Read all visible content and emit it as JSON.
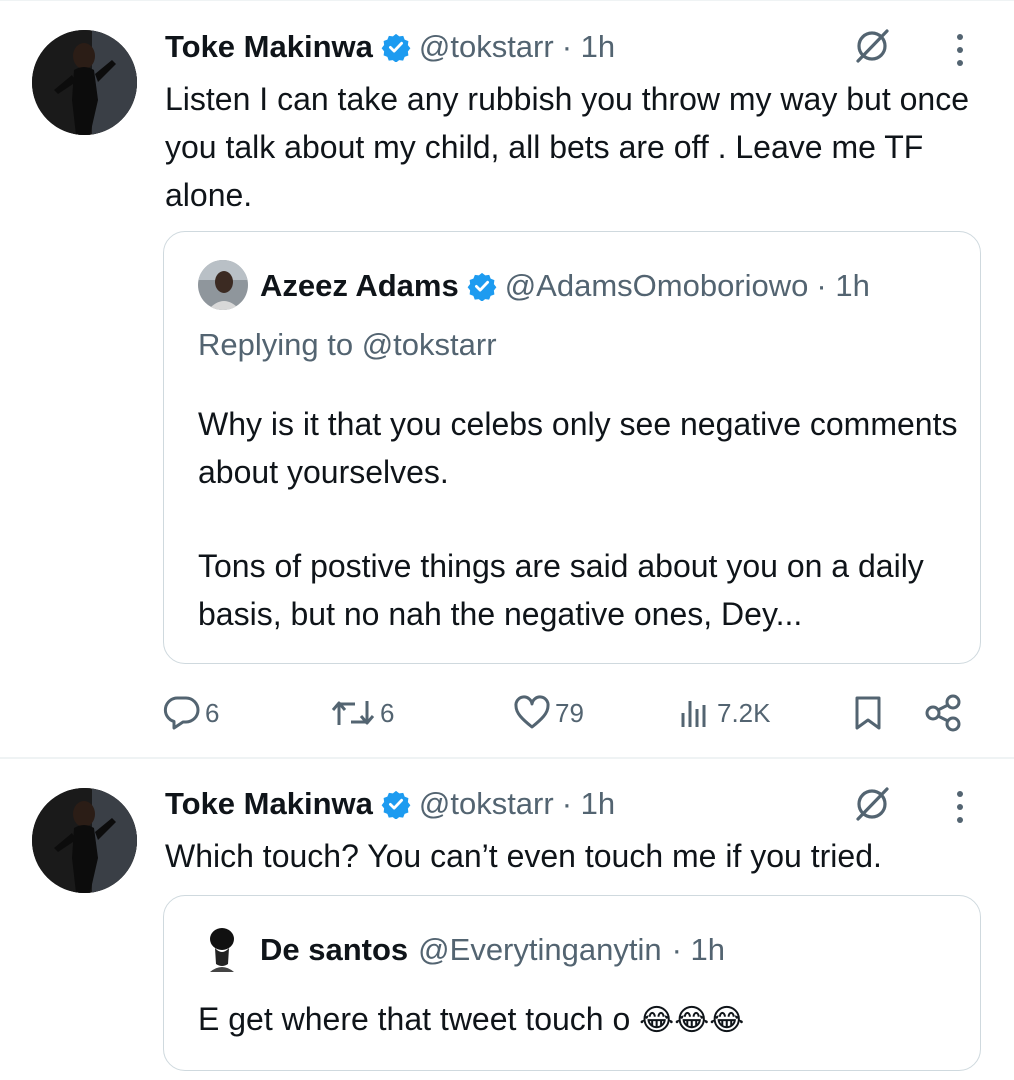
{
  "tweets": [
    {
      "author_name": "Toke Makinwa",
      "author_handle": "@tokstarr",
      "time": "· 1h",
      "text": "Listen I can take any rubbish you throw my way but once you talk about my child, all bets are off . Leave me TF alone.",
      "quote": {
        "author_name": "Azeez Adams",
        "author_handle": "@AdamsOmoboriowo",
        "time": "· 1h",
        "replying_to": "Replying to @tokstarr",
        "text_1": "Why is it that you celebs only see negative comments about yourselves.",
        "text_2": "Tons of postive things are said about you on a daily basis, but no nah the negative ones, Dey..."
      },
      "actions": {
        "replies": "6",
        "retweets": "6",
        "likes": "79",
        "views": "7.2K"
      }
    },
    {
      "author_name": "Toke Makinwa",
      "author_handle": "@tokstarr",
      "time": "· 1h",
      "text": "Which touch? You can’t even touch me if you tried.",
      "quote": {
        "author_name": "De santos",
        "author_handle": "@Everytinganytin",
        "time": "· 1h",
        "text": "E get where that tweet touch o",
        "emoji": "😂😂😂"
      }
    }
  ],
  "colors": {
    "verified": "#1d9bf0",
    "secondary_text": "#536471",
    "border": "#cfd9de"
  },
  "icons": [
    "grok-icon",
    "more-icon",
    "reply-icon",
    "retweet-icon",
    "like-icon",
    "views-icon",
    "bookmark-icon",
    "share-icon",
    "verified-badge-icon"
  ]
}
